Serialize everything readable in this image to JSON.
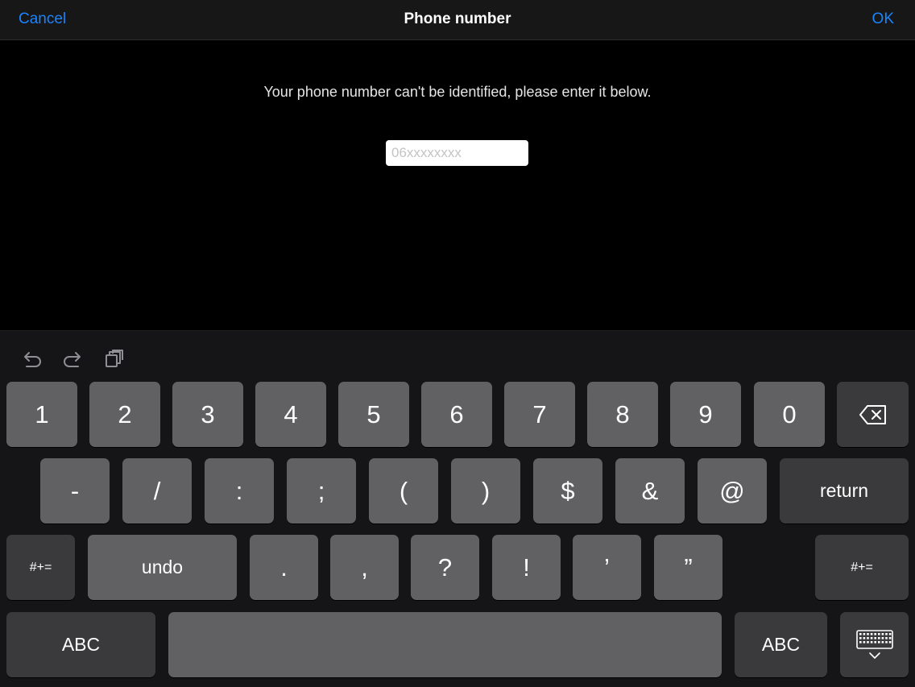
{
  "navbar": {
    "cancel_label": "Cancel",
    "title": "Phone number",
    "ok_label": "OK"
  },
  "message": "Your phone number can't be identified, please enter it below.",
  "phone_input": {
    "value": "",
    "placeholder": "06xxxxxxxx"
  },
  "keyboard": {
    "toolbar": [
      "undo-arrow-icon",
      "redo-arrow-icon",
      "paste-clipboard-icon"
    ],
    "row1": [
      "1",
      "2",
      "3",
      "4",
      "5",
      "6",
      "7",
      "8",
      "9",
      "0"
    ],
    "row2": [
      "-",
      "/",
      ":",
      ";",
      "(",
      ")",
      "$",
      "&",
      "@"
    ],
    "return_label": "return",
    "row3_symbols": [
      ".",
      ",",
      "?",
      "!",
      "’",
      "”"
    ],
    "shift_label": "#+=",
    "undo_label": "undo",
    "abc_label": "ABC",
    "icons": {
      "backspace": "backspace-icon",
      "dismiss": "keyboard-dismiss-icon"
    }
  },
  "colors": {
    "accent": "#1a84ff",
    "key_light": "#616163",
    "key_dark": "#3a3a3c",
    "keyboard_bg": "#151517"
  }
}
